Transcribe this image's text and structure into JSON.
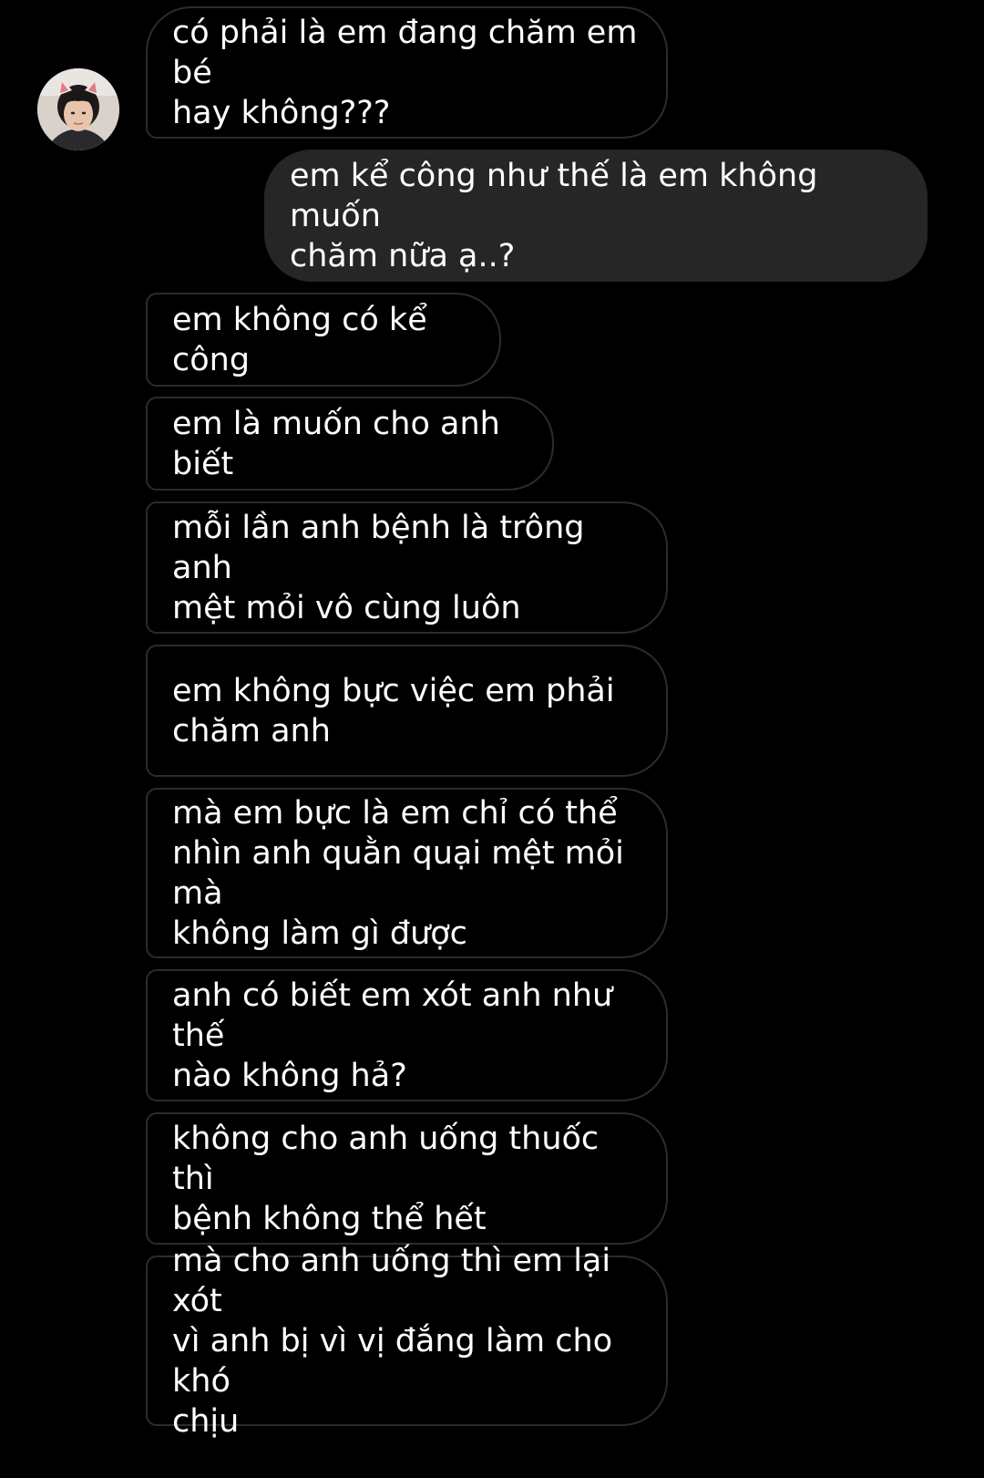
{
  "conversation": {
    "messages": [
      {
        "sender": "them",
        "text": "có phải là em đang chăm em bé\nhay không???"
      },
      {
        "sender": "me",
        "text": "em kể công như thế là em không muốn\nchăm nữa ạ..?"
      },
      {
        "sender": "them",
        "text": "em không có kể công"
      },
      {
        "sender": "them",
        "text": "em là muốn cho anh biết"
      },
      {
        "sender": "them",
        "text": "mỗi lần anh bệnh là trông anh\nmệt mỏi vô cùng luôn"
      },
      {
        "sender": "them",
        "text": "em không bực việc em phải\nchăm anh"
      },
      {
        "sender": "them",
        "text": "mà em bực là em chỉ có thể\nnhìn anh quằn quại mệt mỏi mà\nkhông làm gì được"
      },
      {
        "sender": "them",
        "text": "anh có biết em xót anh như thế\nnào không hả?"
      },
      {
        "sender": "them",
        "text": "không cho anh uống thuốc thì\nbệnh không thể hết"
      },
      {
        "sender": "them",
        "text": "mà cho anh uống thì em lại xót\nvì anh bị vì vị đắng làm cho khó\nchịu"
      }
    ]
  },
  "colors": {
    "background": "#000000",
    "incoming_border": "#2c2c2c",
    "outgoing_fill": "#262626",
    "text": "#ffffff"
  }
}
